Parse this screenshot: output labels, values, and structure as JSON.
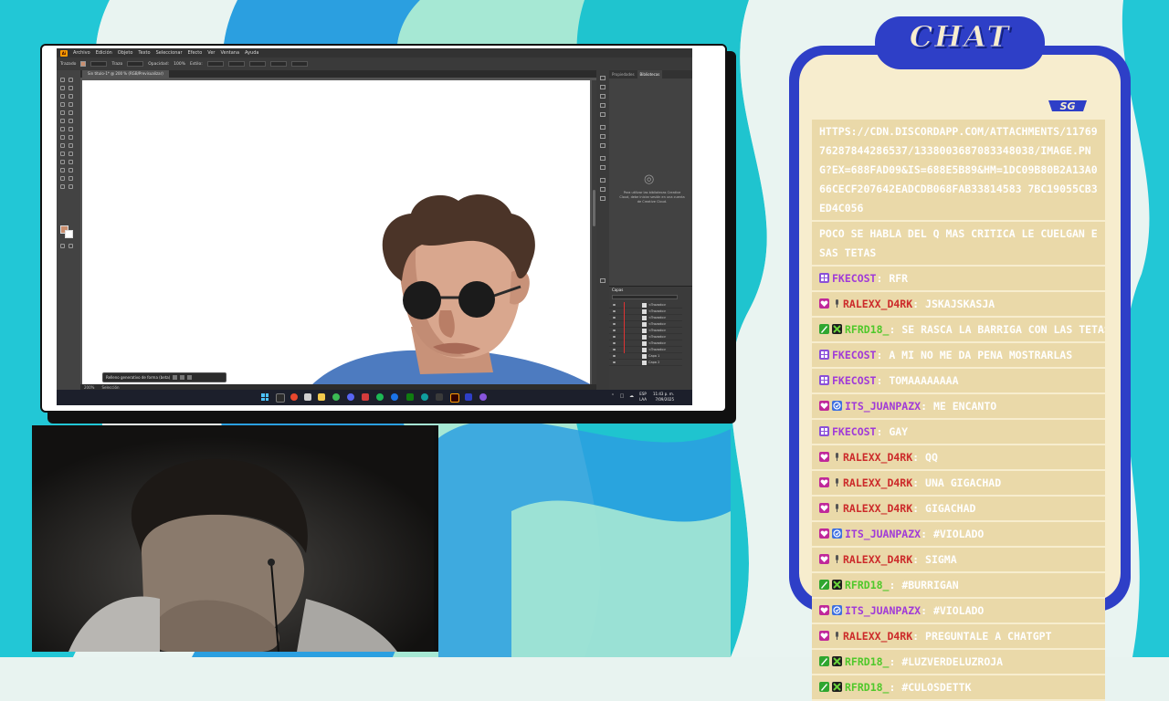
{
  "colors": {
    "chat_frame": "#2e3fc7",
    "chat_panel": "#f7edce",
    "chat_row": "#ead9a9",
    "user_purple": "#a03ad8",
    "user_red": "#cc2a2a",
    "user_green": "#4fc82a",
    "skin_swatch": "#c98e6e"
  },
  "chat": {
    "title": "CHAT",
    "logo": "SG",
    "messages": [
      {
        "user": "",
        "badges": [],
        "color": "",
        "text": "HTTPS://CDN.DISCORDAPP.COM/ATTACHMENTS/1176976287844286537/1338003687083348038/IMAGE.PNG?EX=688FAD09&IS=688E5B89&HM=1DC09B80B2A13A066CECF207642EADCDB068FAB33814583 7BC19055CB3ED4C056"
      },
      {
        "user": "",
        "badges": [],
        "color": "",
        "text": "POCO SE HABLA DEL Q MAS CRITICA LE CUELGAN ESAS TETAS"
      },
      {
        "user": "FKECOST",
        "badges": [
          "sub-badge"
        ],
        "color": "#a03ad8",
        "text": "RFR"
      },
      {
        "user": "RALEXX_D4RK",
        "badges": [
          "heart-badge",
          "mic-badge"
        ],
        "color": "#cc2a2a",
        "text": "JSKAJSKASJA"
      },
      {
        "user": "RFRD18_",
        "badges": [
          "brush-badge",
          "xbox-badge"
        ],
        "color": "#4fc82a",
        "text": "SE RASCA LA BARRIGA CON LAS TETAS"
      },
      {
        "user": "FKECOST",
        "badges": [
          "sub-badge"
        ],
        "color": "#a03ad8",
        "text": "A MI NO ME DA PENA MOSTRARLAS"
      },
      {
        "user": "FKECOST",
        "badges": [
          "sub-badge"
        ],
        "color": "#a03ad8",
        "text": "TOMAAAAAAAA"
      },
      {
        "user": "ITS_JUANPAZX",
        "badges": [
          "heart-badge",
          "verified-badge"
        ],
        "color": "#a03ad8",
        "text": "ME ENCANTO"
      },
      {
        "user": "FKECOST",
        "badges": [
          "sub-badge"
        ],
        "color": "#a03ad8",
        "text": "GAY"
      },
      {
        "user": "RALEXX_D4RK",
        "badges": [
          "heart-badge",
          "mic-badge"
        ],
        "color": "#cc2a2a",
        "text": "QQ"
      },
      {
        "user": "RALEXX_D4RK",
        "badges": [
          "heart-badge",
          "mic-badge"
        ],
        "color": "#cc2a2a",
        "text": "UNA GIGACHAD"
      },
      {
        "user": "RALEXX_D4RK",
        "badges": [
          "heart-badge",
          "mic-badge"
        ],
        "color": "#cc2a2a",
        "text": "GIGACHAD"
      },
      {
        "user": "ITS_JUANPAZX",
        "badges": [
          "heart-badge",
          "verified-badge"
        ],
        "color": "#a03ad8",
        "text": "#VIOLADO"
      },
      {
        "user": "RALEXX_D4RK",
        "badges": [
          "heart-badge",
          "mic-badge"
        ],
        "color": "#cc2a2a",
        "text": "SIGMA"
      },
      {
        "user": "RFRD18_",
        "badges": [
          "brush-badge",
          "xbox-badge"
        ],
        "color": "#4fc82a",
        "text": "#BURRIGAN"
      },
      {
        "user": "ITS_JUANPAZX",
        "badges": [
          "heart-badge",
          "verified-badge"
        ],
        "color": "#a03ad8",
        "text": "#VIOLADO"
      },
      {
        "user": "RALEXX_D4RK",
        "badges": [
          "heart-badge",
          "mic-badge"
        ],
        "color": "#cc2a2a",
        "text": "PREGUNTALE A CHATGPT"
      },
      {
        "user": "RFRD18_",
        "badges": [
          "brush-badge",
          "xbox-badge"
        ],
        "color": "#4fc82a",
        "text": "#LUZVERDELUZROJA"
      },
      {
        "user": "RFRD18_",
        "badges": [
          "brush-badge",
          "xbox-badge"
        ],
        "color": "#4fc82a",
        "text": "#CULOSDETTK"
      }
    ]
  },
  "illustrator": {
    "logo": "Ai",
    "menu": [
      "Archivo",
      "Edición",
      "Objeto",
      "Texto",
      "Seleccionar",
      "Efecto",
      "Ver",
      "Ventana",
      "Ayuda"
    ],
    "control": {
      "selection": "Trazado",
      "stroke_label": "Trazo",
      "opacity_label": "Opacidad:",
      "opacity_value": "100%",
      "style_label": "Estilo:"
    },
    "doc_tab": "Sin título-1* @ 200 % (RGB/Previsualizar)",
    "context_bar": "Relleno generativo de forma (beta)",
    "status": {
      "zoom": "200%",
      "tool": "Selección"
    },
    "panel_tabs": [
      "Propiedades",
      "Bibliotecas"
    ],
    "cc_message": "Para utilizar las bibliotecas Creative Cloud, debe iniciar sesión en una cuenta de Creative Cloud.",
    "layers_tab": "Capas",
    "layers": [
      "<Trazado>",
      "<Trazado>",
      "<Trazado>",
      "<Trazado>",
      "<Trazado>",
      "<Trazado>",
      "<Trazado>",
      "<Trazado>",
      "Capa 1",
      "Capa 2"
    ]
  },
  "taskbar": {
    "lang_top": "ESP",
    "lang_bottom": "LAA",
    "time": "11:43 p. m.",
    "date": "7/09/2025"
  }
}
